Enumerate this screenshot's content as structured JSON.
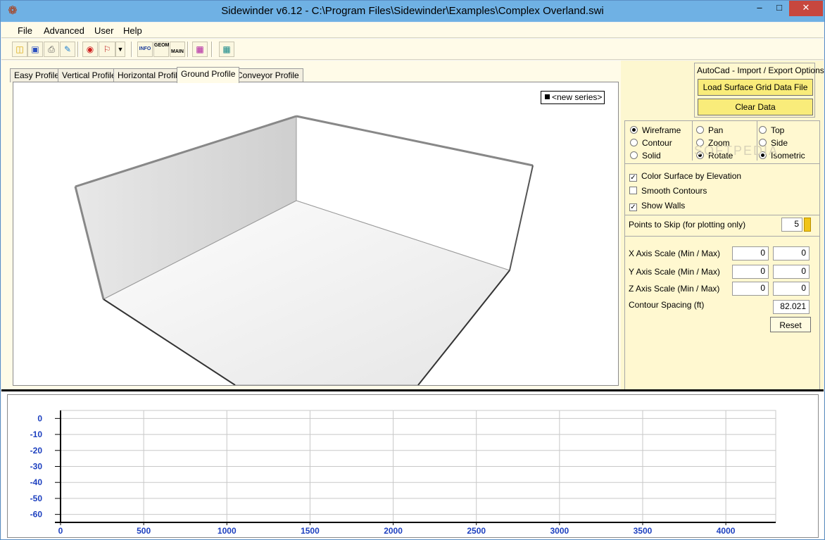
{
  "window": {
    "title": "Sidewinder v6.12 - C:\\Program Files\\Sidewinder\\Examples\\Complex Overland.swi",
    "min_glyph": "–",
    "max_glyph": "□",
    "close_glyph": "✕"
  },
  "menu": [
    "File",
    "Advanced",
    "User",
    "Help"
  ],
  "toolbar": {
    "icons": [
      "open-folder-icon",
      "save-disk-icon",
      "print-icon",
      "edit-icon",
      "report-icon",
      "flag-icon",
      "info-icon",
      "geom-icon",
      "main-icon",
      "chart-icon",
      "calculator-icon"
    ],
    "info_label": "INFO",
    "geom_label": "GEOM",
    "main_label": "MAIN"
  },
  "tabs": [
    {
      "label": "Easy Profile",
      "active": false
    },
    {
      "label": "Vertical Profile",
      "active": false
    },
    {
      "label": "Horizontal Profile",
      "active": false
    },
    {
      "label": "Ground Profile",
      "active": true
    },
    {
      "label": "Conveyor Profile",
      "active": false
    }
  ],
  "plot3d": {
    "legend_label": "<new series>"
  },
  "autocad": {
    "title": "AutoCad - Import / Export Options",
    "load_button": "Load Surface Grid Data File",
    "clear_button": "Clear Data"
  },
  "view_mode": {
    "col1": [
      {
        "label": "Wireframe",
        "checked": true
      },
      {
        "label": "Contour",
        "checked": false
      },
      {
        "label": "Solid",
        "checked": false
      }
    ],
    "col2": [
      {
        "label": "Pan",
        "checked": false
      },
      {
        "label": "Zoom",
        "checked": false
      },
      {
        "label": "Rotate",
        "checked": true
      }
    ],
    "col3": [
      {
        "label": "Top",
        "checked": false
      },
      {
        "label": "Side",
        "checked": false
      },
      {
        "label": "Isometric",
        "checked": true
      }
    ]
  },
  "options": [
    {
      "label": "Color Surface by Elevation",
      "checked": true
    },
    {
      "label": "Smooth Contours",
      "checked": false
    },
    {
      "label": "Show Walls",
      "checked": true
    }
  ],
  "points_skip": {
    "label": "Points to Skip (for plotting only)",
    "value": "5"
  },
  "scales": {
    "x_label": "X Axis Scale (Min / Max)",
    "x_min": "0",
    "x_max": "0",
    "y_label": "Y Axis Scale (Min / Max)",
    "y_min": "0",
    "y_max": "0",
    "z_label": "Z Axis Scale (Min / Max)",
    "z_min": "0",
    "z_max": "0",
    "contour_label": "Contour Spacing (ft)",
    "contour_value": "82.021",
    "reset_button": "Reset"
  },
  "watermark": "SOFTPEDIA",
  "chart_data": {
    "type": "line",
    "title": "",
    "xlabel": "",
    "ylabel": "",
    "xlim": [
      0,
      4300
    ],
    "ylim": [
      -65,
      5
    ],
    "x_ticks": [
      0,
      500,
      1000,
      1500,
      2000,
      2500,
      3000,
      3500,
      4000
    ],
    "y_ticks": [
      0,
      -10,
      -20,
      -30,
      -40,
      -50,
      -60
    ],
    "grid": true,
    "series": [],
    "tick_color": "#1c3fbf"
  }
}
